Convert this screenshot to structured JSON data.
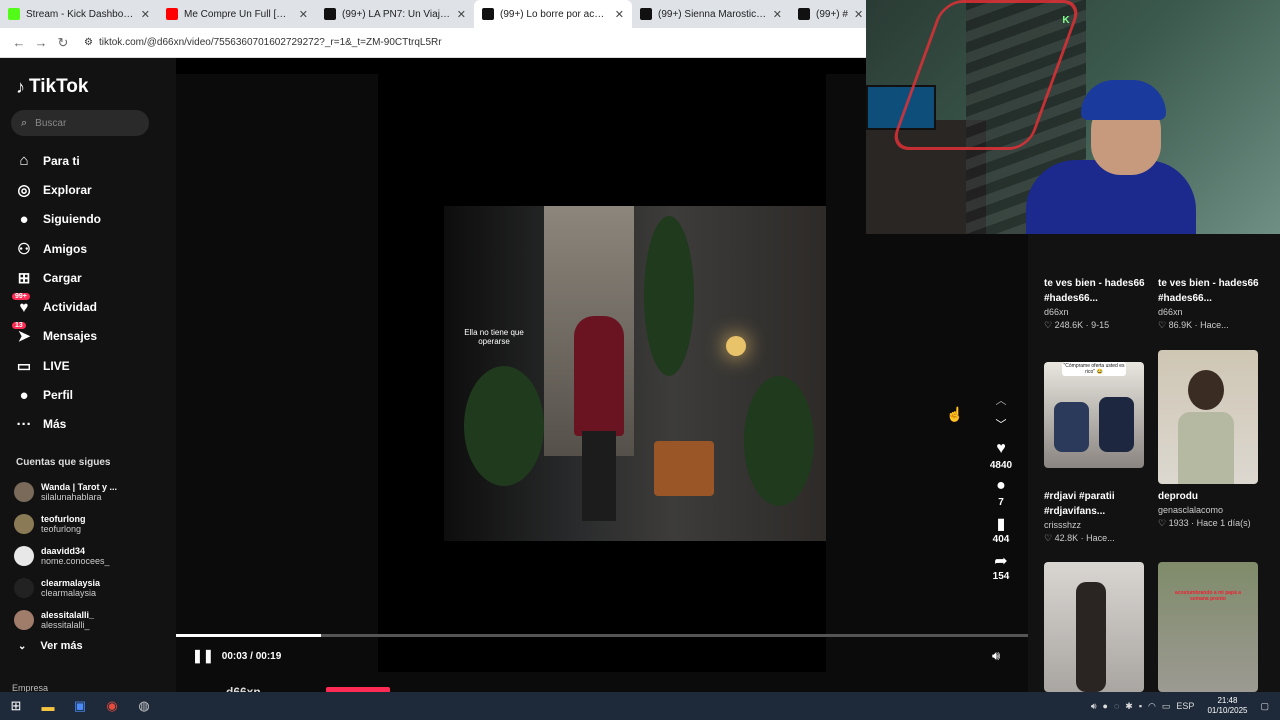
{
  "browser": {
    "tabs": [
      {
        "title": "Stream - Kick Dashboard",
        "color": "#53fc18",
        "active": false
      },
      {
        "title": "Me Compre Un Full [Oficial Vi...",
        "color": "#ff0000",
        "active": false
      },
      {
        "title": "(99+) LA PN7: Un Viaje Inolvida...",
        "color": "#111111",
        "active": false
      },
      {
        "title": "(99+) Lo borre por accidente 😭",
        "color": "#111111",
        "active": true
      },
      {
        "title": "(99+) Sienna Marostica: Efectiv...",
        "color": "#111111",
        "active": false
      },
      {
        "title": "(99+) #",
        "color": "#111111",
        "active": false
      }
    ],
    "url": "tiktok.com/@d66xn/video/7556360701602729272?_r=1&_t=ZM-90CTtrqL5Rr"
  },
  "sidebar": {
    "logo": "TikTok",
    "search_placeholder": "Buscar",
    "nav": [
      {
        "label": "Para ti",
        "icon": "home-icon",
        "glyph": "⌂"
      },
      {
        "label": "Explorar",
        "icon": "compass-icon",
        "glyph": "◎"
      },
      {
        "label": "Siguiendo",
        "icon": "following-avatar-icon",
        "glyph": "●"
      },
      {
        "label": "Amigos",
        "icon": "friends-icon",
        "glyph": "⚇"
      },
      {
        "label": "Cargar",
        "icon": "upload-icon",
        "glyph": "⊞"
      },
      {
        "label": "Actividad",
        "icon": "activity-icon",
        "glyph": "♥",
        "badge": "99+"
      },
      {
        "label": "Mensajes",
        "icon": "messages-icon",
        "glyph": "➤",
        "badge": "13"
      },
      {
        "label": "LIVE",
        "icon": "live-icon",
        "glyph": "▭"
      },
      {
        "label": "Perfil",
        "icon": "profile-avatar-icon",
        "glyph": "●"
      },
      {
        "label": "Más",
        "icon": "more-icon",
        "glyph": "···"
      }
    ],
    "following_header": "Cuentas que sigues",
    "following": [
      {
        "name": "Wanda | Tarot y ...",
        "user": "silalunahablara"
      },
      {
        "name": "teofurlong",
        "user": "teofurlong"
      },
      {
        "name": "daavidd34",
        "user": "nome.conocees_"
      },
      {
        "name": "clearmalaysia",
        "user": "clearmalaysia"
      },
      {
        "name": "alessitalalli_",
        "user": "alessitalalli_"
      }
    ],
    "see_more": "Ver más",
    "company": "Empresa"
  },
  "video": {
    "caption": "Ella no tiene que operarse",
    "time": "00:03 / 00:19",
    "progress": 0.17,
    "author": "d66xn"
  },
  "actions": {
    "likes": "4840",
    "comments": "7",
    "saves": "404",
    "shares": "154"
  },
  "recommendations": [
    {
      "title": "te ves bien - hades66 #hades66...",
      "user": "d66xn",
      "stats": "248.6K · 9-15"
    },
    {
      "title": "te ves bien - hades66 #hades66...",
      "user": "d66xn",
      "stats": "86.9K · Hace..."
    },
    {
      "title": "#rdjavi #paratii #rdjavifans...",
      "user": "crissshzz",
      "stats": "42.8K · Hace..."
    },
    {
      "title": "deprodu",
      "user": "genasclalacomo",
      "stats": "1933 · Hace 1 día(s)"
    }
  ],
  "thumb_texts": {
    "t1": "\"Cómprame oferta usted es rico\" 😂",
    "t4": "acostumbrando a mi papá a semana pronto"
  },
  "webcam": {
    "sign": "K"
  },
  "taskbar": {
    "lang": "ESP",
    "time": "21:48",
    "date": "01/10/2025"
  }
}
